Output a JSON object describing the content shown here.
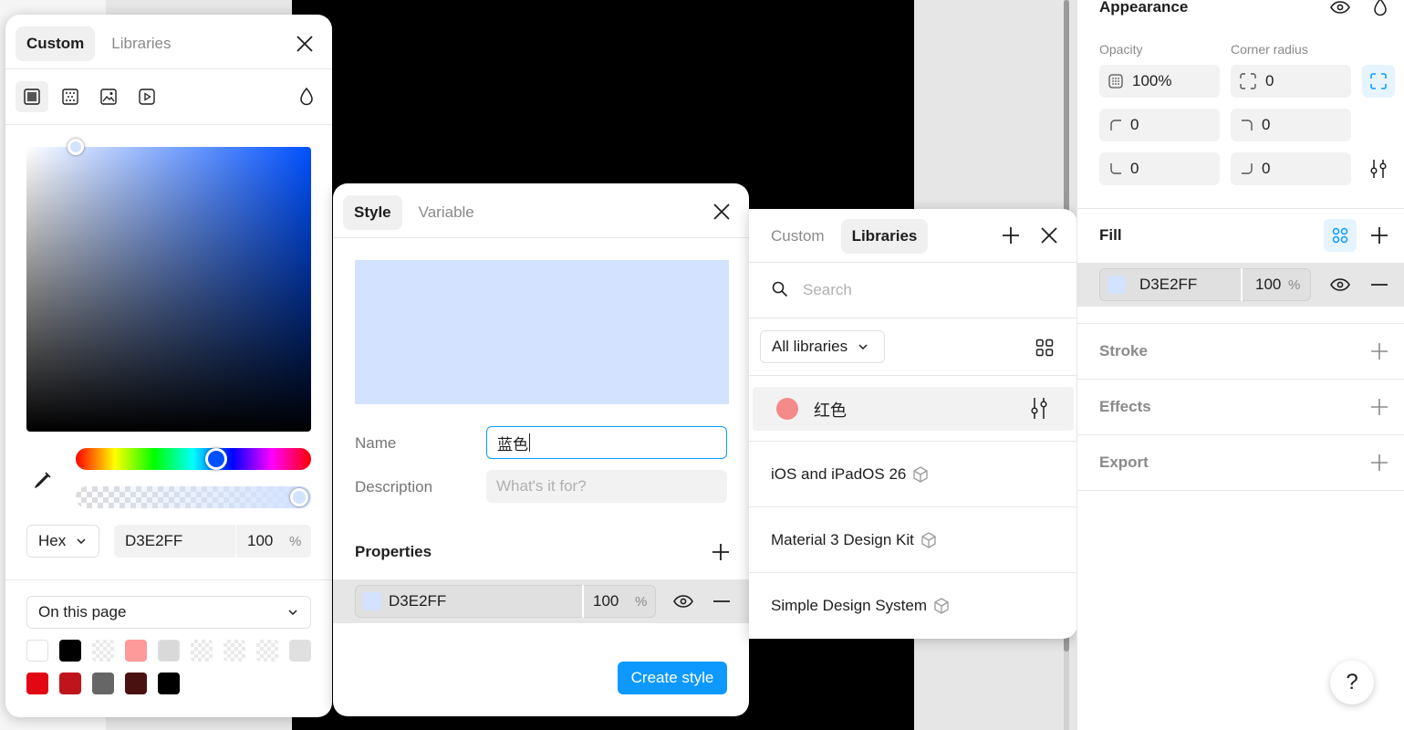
{
  "picker": {
    "tabs": [
      "Custom",
      "Libraries"
    ],
    "mode_label": "Hex",
    "hex": "D3E2FF",
    "opacity": "100",
    "percent": "%",
    "swatch_scope": "On this page",
    "swatch_colors": [
      "#ffffff",
      "#000000",
      "#f5f5f5",
      "#ff9a9a",
      "#d9d9d9",
      "#f5f5f5",
      "#f5f5f5",
      "#f5f5f5",
      "#e0e0e0",
      "#e30613",
      "#c0141c",
      "#666666",
      "#4a1111",
      "#000000"
    ]
  },
  "style_panel": {
    "tabs": [
      "Style",
      "Variable"
    ],
    "preview_color": "#d3e2ff",
    "name_label": "Name",
    "name_value": "蓝色",
    "description_label": "Description",
    "description_placeholder": "What's it for?",
    "properties_label": "Properties",
    "fill_hex": "D3E2FF",
    "fill_opacity": "100",
    "percent": "%",
    "create_button": "Create style"
  },
  "libraries_panel": {
    "tabs": [
      "Custom",
      "Libraries"
    ],
    "search_placeholder": "Search",
    "filter": "All libraries",
    "local_style_name": "红色",
    "local_style_color": "#f48a8a",
    "libraries": [
      "iOS and iPadOS 26",
      "Material 3 Design Kit",
      "Simple Design System"
    ]
  },
  "properties": {
    "appearance_title": "Appearance",
    "opacity_label": "Opacity",
    "corner_radius_label": "Corner radius",
    "opacity_value": "100%",
    "radius_all": "0",
    "radius_tl": "0",
    "radius_tr": "0",
    "radius_bl": "0",
    "radius_br": "0",
    "fill_title": "Fill",
    "fill_hex": "D3E2FF",
    "fill_opacity": "100",
    "percent": "%",
    "stroke_title": "Stroke",
    "effects_title": "Effects",
    "export_title": "Export",
    "help": "?"
  },
  "colors": {
    "accent": "#0d99ff",
    "fill_color": "#d3e2ff"
  }
}
